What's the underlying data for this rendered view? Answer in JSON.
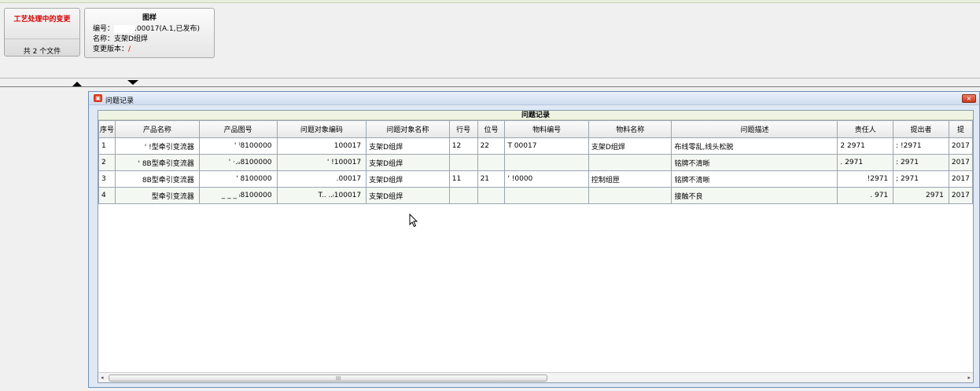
{
  "process_card": {
    "title": "工艺处理中的变更",
    "count": "共 2 个文件"
  },
  "drawing_card": {
    "title": "图样",
    "number_label": "编号：",
    "number_value": ".00017(A.1,已发布)",
    "name_line": "名称：支架D组焊",
    "version_label": "变更版本：",
    "version_value": "/"
  },
  "dialog": {
    "title": "问题记录",
    "close": "×",
    "table_caption": "问题记录",
    "columns": [
      "序号",
      "产品名称",
      "产品图号",
      "问题对象编码",
      "问题对象名称",
      "行号",
      "位号",
      "物料编号",
      "物料名称",
      "问题描述",
      "责任人",
      "提出者",
      "提"
    ],
    "rows": [
      [
        "1",
        "'      !型牵引变流器",
        "'      ⁾8100000",
        "100017",
        "支架D组焊",
        "12",
        "22",
        "T          00017",
        "支架D组焊",
        "布线零乱,线头松脱",
        "2          2971",
        ":        !2971",
        "2017"
      ],
      [
        "2",
        "'      8B型牵引变流器",
        "' ·.ᵤ8100000",
        "'        !100017",
        "支架D组焊",
        "",
        "",
        "",
        "",
        "铭牌不清晰",
        ".          2971",
        ":         2971",
        "2017"
      ],
      [
        "3",
        "8B型牵引变流器",
        "'       8100000",
        "        .00017",
        "支架D组焊",
        "11",
        "21",
        "'         !0000",
        "控制组匣",
        "铭牌不清晰",
        "!2971",
        ";         2971",
        "2017"
      ],
      [
        "4",
        "型牵引变流器",
        "_ _ _ ᵢ8100000",
        "T.. ..ᵢ100017",
        "支架D组焊",
        "",
        "",
        "",
        "",
        "接触不良",
        ".          971",
        "2971",
        "2017"
      ]
    ]
  },
  "scrollbar": {
    "left_arrow": "◂",
    "right_arrow": "▸",
    "grip": "III"
  }
}
